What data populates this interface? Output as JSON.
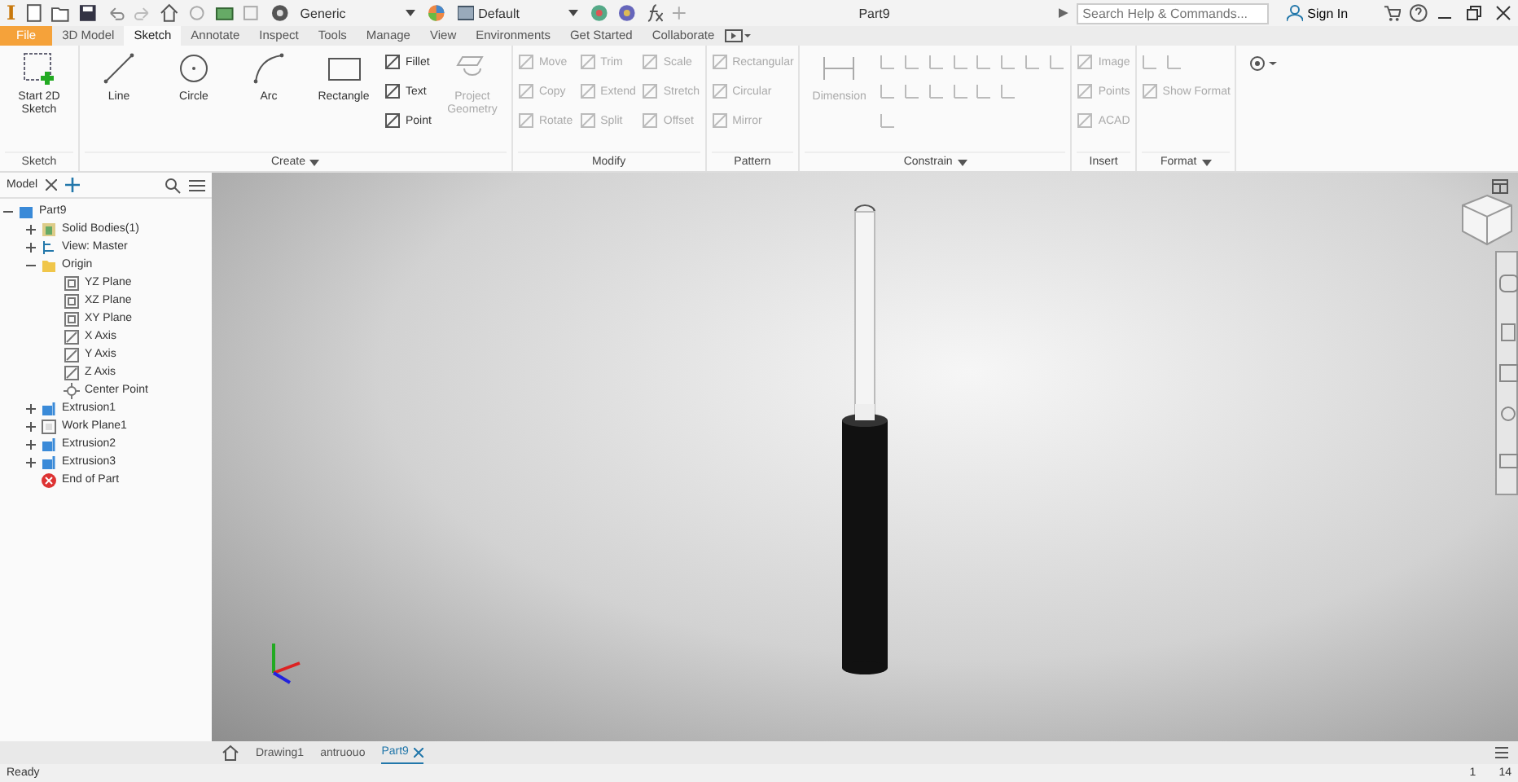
{
  "title_bar": {
    "app_logo": "I",
    "material": "Generic",
    "appearance": "Default",
    "document_title": "Part9",
    "search": {
      "placeholder": "Search Help & Commands..."
    },
    "sign_in": "Sign In"
  },
  "ribbon_tabs": [
    {
      "label": "File",
      "kind": "file",
      "selected": false
    },
    {
      "label": "3D Model",
      "kind": "tab",
      "selected": false
    },
    {
      "label": "Sketch",
      "kind": "tab",
      "selected": true
    },
    {
      "label": "Annotate",
      "kind": "tab",
      "selected": false
    },
    {
      "label": "Inspect",
      "kind": "tab",
      "selected": false
    },
    {
      "label": "Tools",
      "kind": "tab",
      "selected": false
    },
    {
      "label": "Manage",
      "kind": "tab",
      "selected": false
    },
    {
      "label": "View",
      "kind": "tab",
      "selected": false
    },
    {
      "label": "Environments",
      "kind": "tab",
      "selected": false
    },
    {
      "label": "Get Started",
      "kind": "tab",
      "selected": false
    },
    {
      "label": "Collaborate",
      "kind": "tab",
      "selected": false
    }
  ],
  "ribbon_panels": [
    {
      "title": "Sketch",
      "menu": false,
      "tools": [
        {
          "label": "Start 2D Sketch",
          "kind": "large",
          "disabled": false
        }
      ]
    },
    {
      "title": "Create",
      "menu": true,
      "tools": [
        {
          "label": "Line",
          "kind": "large",
          "disabled": false
        },
        {
          "label": "Circle",
          "kind": "large",
          "disabled": false
        },
        {
          "label": "Arc",
          "kind": "large",
          "disabled": false
        },
        {
          "label": "Rectangle",
          "kind": "large",
          "disabled": false
        },
        {
          "label": "Fillet",
          "kind": "small",
          "disabled": false
        },
        {
          "label": "Text",
          "kind": "small",
          "disabled": false
        },
        {
          "label": "Point",
          "kind": "small",
          "disabled": false
        },
        {
          "label": "Project Geometry",
          "kind": "large",
          "disabled": true
        }
      ]
    },
    {
      "title": "Modify",
      "menu": false,
      "tools": [
        {
          "label": "Move",
          "kind": "small",
          "disabled": true
        },
        {
          "label": "Copy",
          "kind": "small",
          "disabled": true
        },
        {
          "label": "Rotate",
          "kind": "small",
          "disabled": true
        },
        {
          "label": "Trim",
          "kind": "small",
          "disabled": true
        },
        {
          "label": "Extend",
          "kind": "small",
          "disabled": true
        },
        {
          "label": "Split",
          "kind": "small",
          "disabled": true
        },
        {
          "label": "Scale",
          "kind": "small",
          "disabled": true
        },
        {
          "label": "Stretch",
          "kind": "small",
          "disabled": true
        },
        {
          "label": "Offset",
          "kind": "small",
          "disabled": true
        }
      ]
    },
    {
      "title": "Pattern",
      "menu": false,
      "tools": [
        {
          "label": "Rectangular",
          "kind": "small",
          "disabled": true
        },
        {
          "label": "Circular",
          "kind": "small",
          "disabled": true
        },
        {
          "label": "Mirror",
          "kind": "small",
          "disabled": true
        }
      ]
    },
    {
      "title": "Constrain",
      "menu": true,
      "tools": [
        {
          "label": "Dimension",
          "kind": "large",
          "disabled": true
        },
        {
          "kind": "icon",
          "disabled": true
        },
        {
          "kind": "icon",
          "disabled": true
        },
        {
          "kind": "icon",
          "disabled": true
        },
        {
          "kind": "icon",
          "disabled": true
        },
        {
          "kind": "icon",
          "disabled": true
        },
        {
          "kind": "icon",
          "disabled": true
        },
        {
          "kind": "icon",
          "disabled": true
        },
        {
          "kind": "icon",
          "disabled": true
        },
        {
          "kind": "icon",
          "disabled": true
        },
        {
          "kind": "icon",
          "disabled": true
        },
        {
          "kind": "icon",
          "disabled": true
        },
        {
          "kind": "icon",
          "disabled": true
        },
        {
          "kind": "icon",
          "disabled": true
        },
        {
          "kind": "icon",
          "disabled": true
        },
        {
          "kind": "icon",
          "disabled": true
        }
      ]
    },
    {
      "title": "Insert",
      "menu": false,
      "tools": [
        {
          "label": "Image",
          "kind": "small",
          "disabled": true
        },
        {
          "label": "Points",
          "kind": "small",
          "disabled": true
        },
        {
          "label": "ACAD",
          "kind": "small",
          "disabled": true
        }
      ]
    },
    {
      "title": "Format",
      "menu": true,
      "tools": [
        {
          "kind": "icon",
          "disabled": true
        },
        {
          "kind": "icon",
          "disabled": true
        },
        {
          "label": "Show Format",
          "kind": "small",
          "disabled": true
        }
      ]
    }
  ],
  "browser": {
    "tab": "Model",
    "items": [
      {
        "label": "Part9",
        "kind": "part",
        "expanded": true,
        "children": [
          {
            "label": "Solid Bodies(1)",
            "kind": "solid",
            "expanded": false
          },
          {
            "label": "View: Master",
            "kind": "view",
            "expanded": false
          },
          {
            "label": "Origin",
            "kind": "folder",
            "expanded": true,
            "children": [
              {
                "label": "YZ Plane",
                "kind": "plane"
              },
              {
                "label": "XZ Plane",
                "kind": "plane"
              },
              {
                "label": "XY Plane",
                "kind": "plane"
              },
              {
                "label": "X Axis",
                "kind": "axis"
              },
              {
                "label": "Y Axis",
                "kind": "axis"
              },
              {
                "label": "Z Axis",
                "kind": "axis"
              },
              {
                "label": "Center Point",
                "kind": "point"
              }
            ]
          },
          {
            "label": "Extrusion1",
            "kind": "extrusion",
            "expanded": false
          },
          {
            "label": "Work Plane1",
            "kind": "workplane",
            "expanded": false
          },
          {
            "label": "Extrusion2",
            "kind": "extrusion",
            "expanded": false
          },
          {
            "label": "Extrusion3",
            "kind": "extrusion",
            "expanded": false
          },
          {
            "label": "End of Part",
            "kind": "end"
          }
        ]
      }
    ]
  },
  "document_tabs": [
    {
      "label": "Drawing1",
      "selected": false
    },
    {
      "label": "antruouo",
      "selected": false
    },
    {
      "label": "Part9",
      "selected": true
    }
  ],
  "status_bar": {
    "text": "Ready",
    "values": [
      "1",
      "14"
    ]
  }
}
